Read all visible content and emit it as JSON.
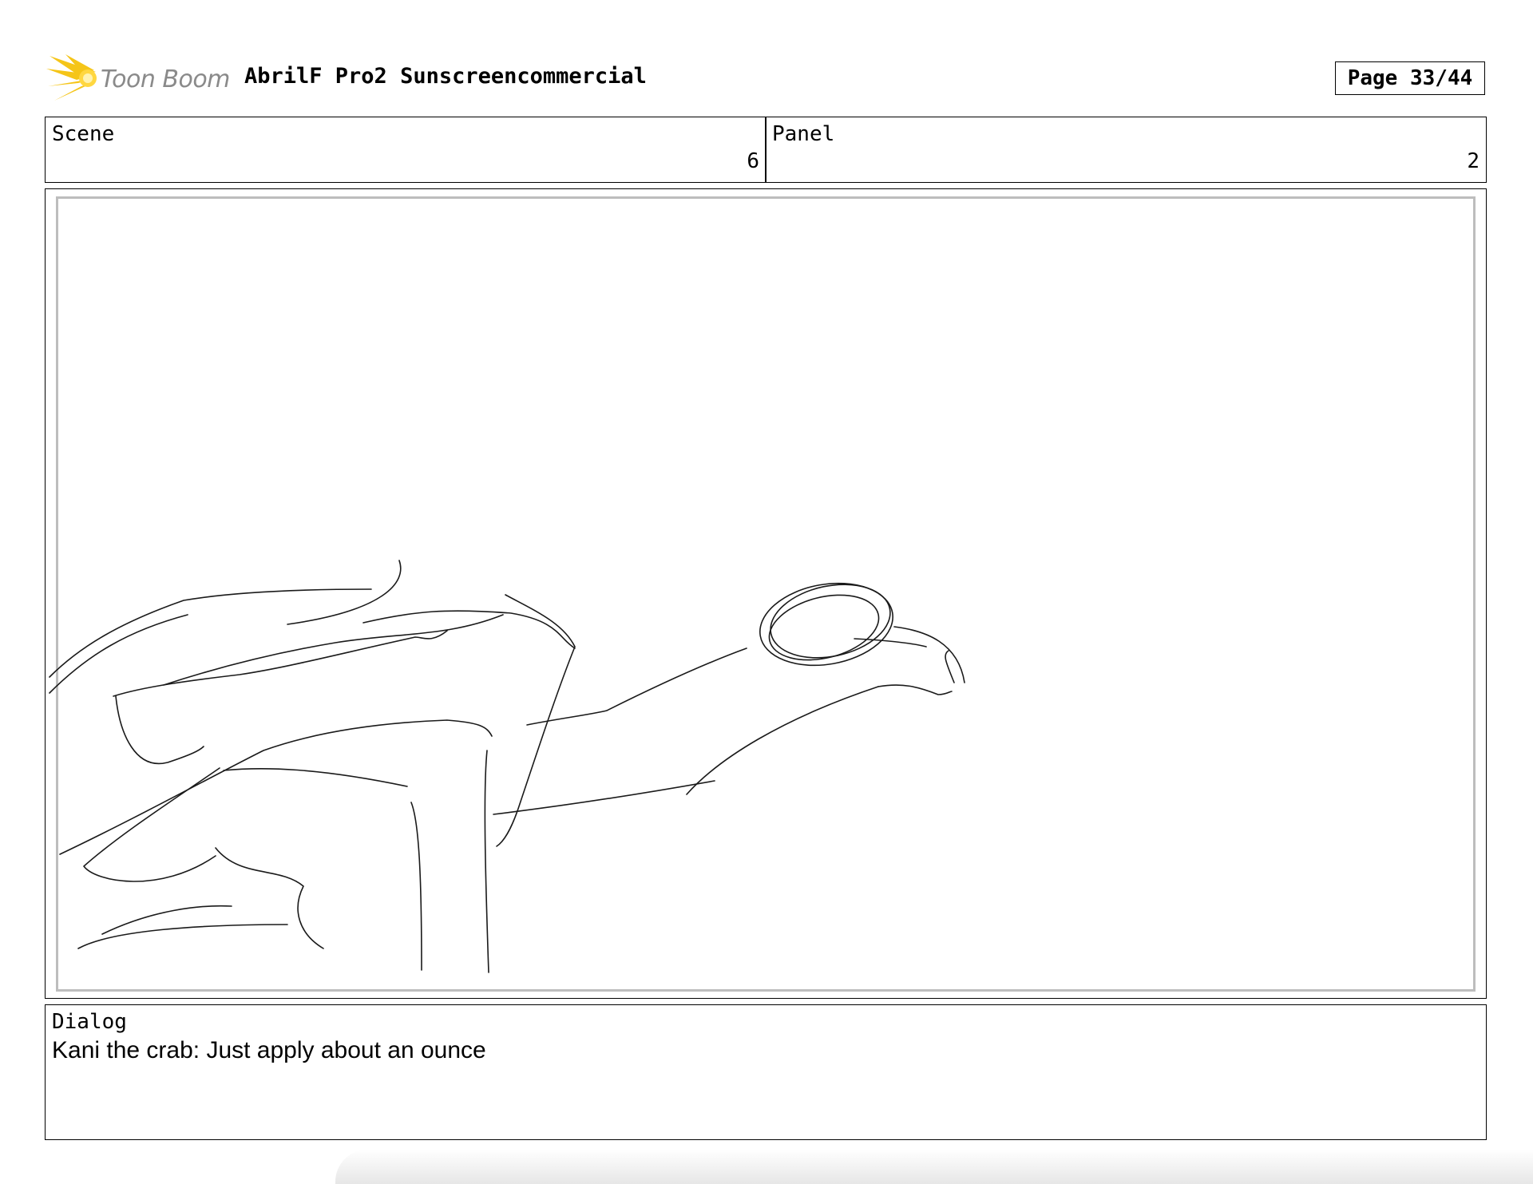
{
  "header": {
    "logo_text": "Toon Boom",
    "logo_color": "#f5c518",
    "project_title": "AbrilF Pro2 Sunscreencommercial",
    "page_label": "Page 33/44"
  },
  "scene": {
    "label": "Scene",
    "value": "6"
  },
  "panel": {
    "label": "Panel",
    "value": "2"
  },
  "dialog": {
    "label": "Dialog",
    "text": "Kani the crab: Just apply about an ounce"
  }
}
